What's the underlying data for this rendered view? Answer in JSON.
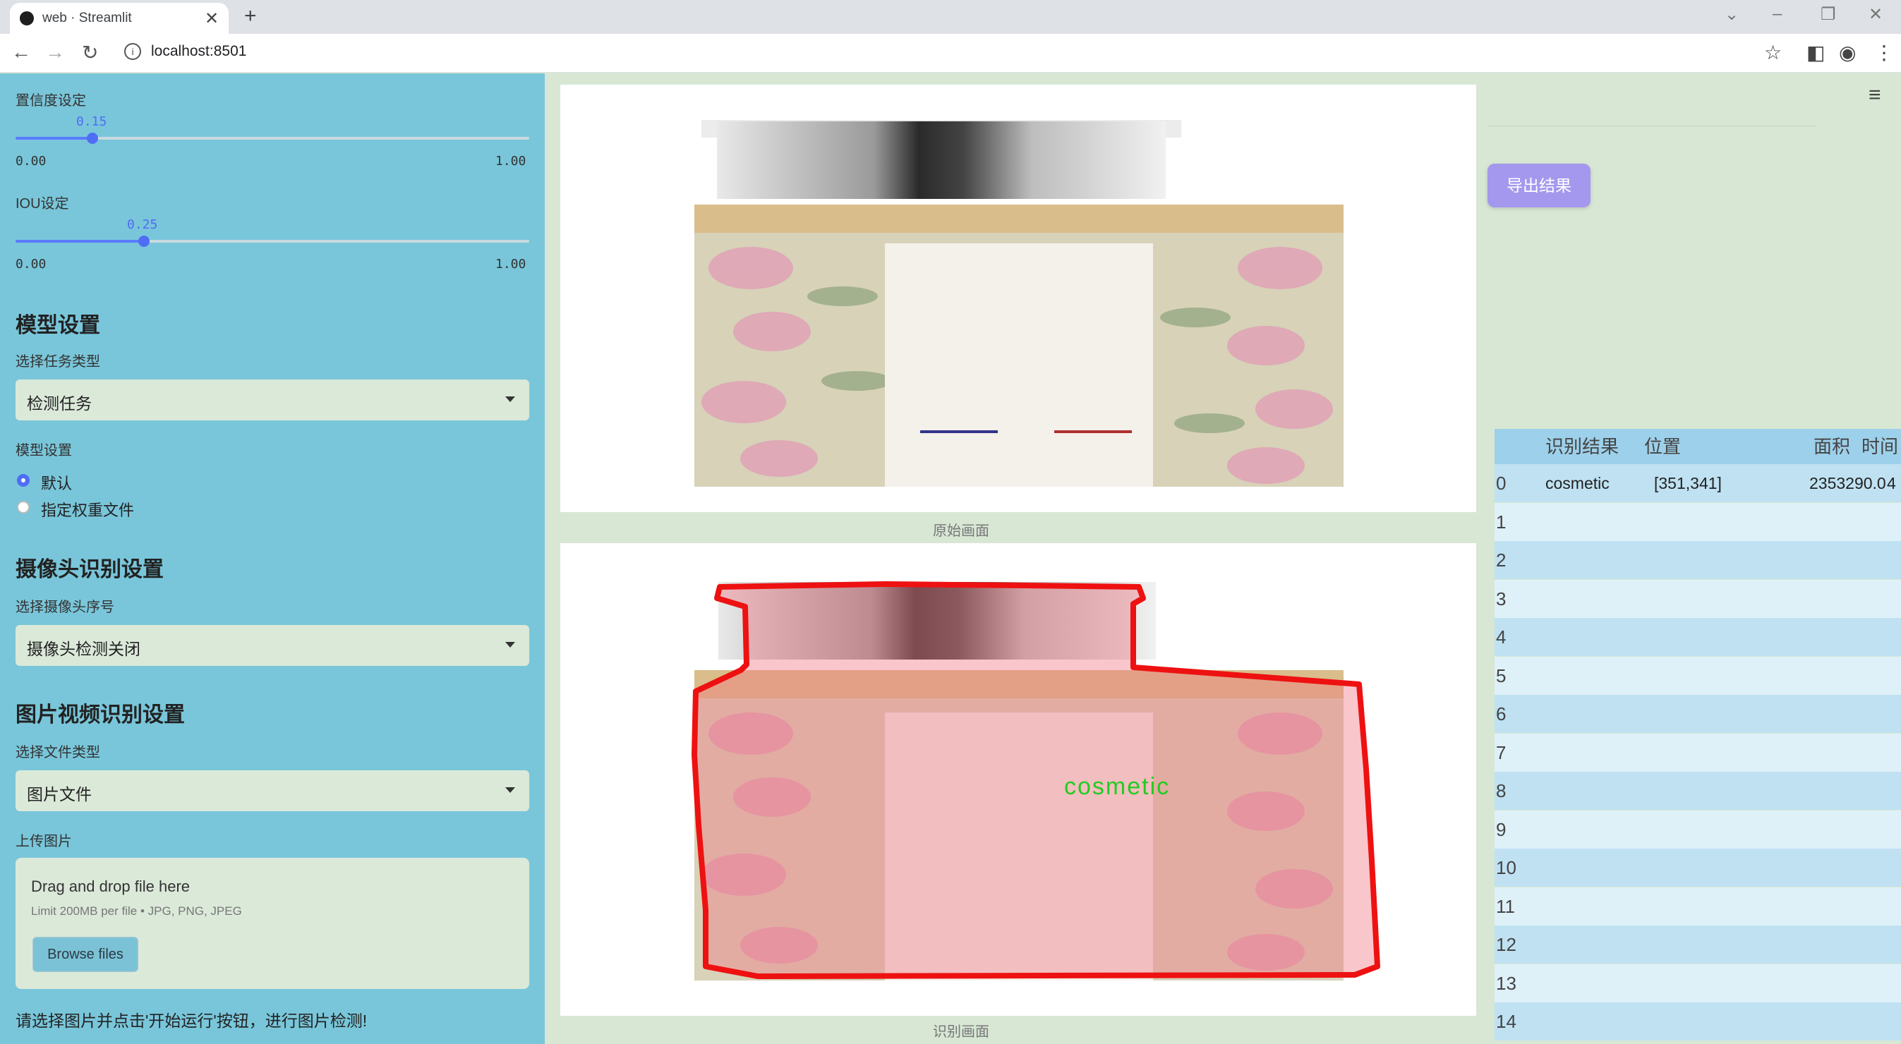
{
  "browser": {
    "tab_title": "web · Streamlit",
    "url": "localhost:8501",
    "close_glyph": "✕",
    "newtab_glyph": "+"
  },
  "sidebar": {
    "confidence": {
      "label": "置信度设定",
      "value": "0.15",
      "min": "0.00",
      "max": "1.00",
      "fraction": 0.15
    },
    "iou": {
      "label": "IOU设定",
      "value": "0.25",
      "min": "0.00",
      "max": "1.00",
      "fraction": 0.25
    },
    "model_header": "模型设置",
    "task_label": "选择任务类型",
    "task_value": "检测任务",
    "model_label": "模型设置",
    "model_options": [
      "默认",
      "指定权重文件"
    ],
    "model_selected": 0,
    "camera_header": "摄像头识别设置",
    "camera_label": "选择摄像头序号",
    "camera_value": "摄像头检测关闭",
    "media_header": "图片视频识别设置",
    "filetype_label": "选择文件类型",
    "filetype_value": "图片文件",
    "upload_label": "上传图片",
    "drop_title": "Drag and drop file here",
    "drop_limit": "Limit 200MB per file • JPG, PNG, JPEG",
    "browse_label": "Browse files",
    "hint": "请选择图片并点击'开始运行'按钮，进行图片检测!"
  },
  "main": {
    "original_caption": "原始画面",
    "result_caption": "识别画面",
    "detection_label": "cosmetic",
    "export_label": "导出结果"
  },
  "table": {
    "headers": [
      "识别结果",
      "位置",
      "面积",
      "时间"
    ],
    "rows": [
      {
        "index": "0",
        "result": "cosmetic",
        "position": "[351,341]",
        "area": "2353290.0",
        "time": "4"
      },
      {
        "index": "1"
      },
      {
        "index": "2"
      },
      {
        "index": "3"
      },
      {
        "index": "4"
      },
      {
        "index": "5"
      },
      {
        "index": "6"
      },
      {
        "index": "7"
      },
      {
        "index": "8"
      },
      {
        "index": "9"
      },
      {
        "index": "10"
      },
      {
        "index": "11"
      },
      {
        "index": "12"
      },
      {
        "index": "13"
      },
      {
        "index": "14"
      }
    ]
  },
  "colors": {
    "sidebar": "#79c6da",
    "accent": "#4f6df5",
    "detection_box": "#ee1111",
    "detection_text": "#22cc22",
    "export": "#a498ee"
  }
}
